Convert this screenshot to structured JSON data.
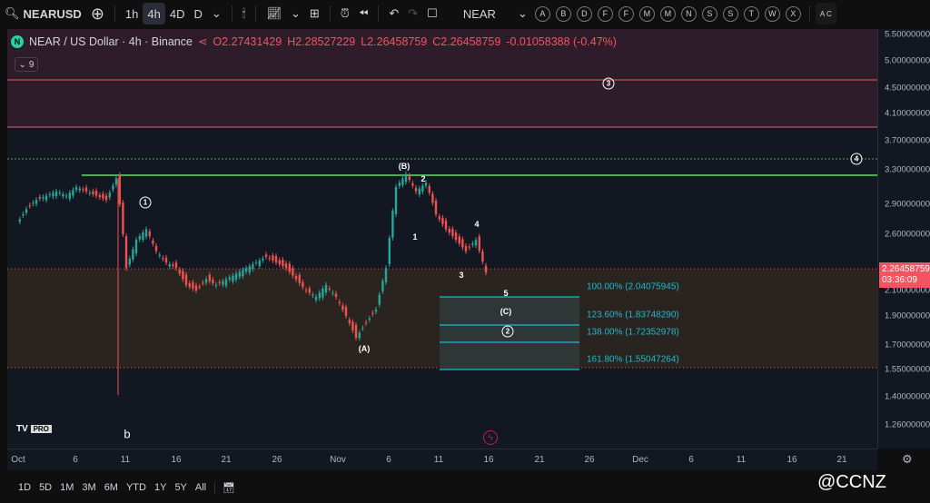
{
  "toolbar": {
    "symbol": "NEARUSD",
    "intervals": [
      "1h",
      "4h",
      "4D",
      "D"
    ],
    "active_interval": "4h",
    "watch_label": "NEAR",
    "letters": [
      "A",
      "B",
      "D",
      "F",
      "F",
      "M",
      "M",
      "N",
      "S",
      "S",
      "T",
      "W",
      "X"
    ],
    "elliott_icon_label": "A C"
  },
  "legend": {
    "title": "NEAR / US Dollar · 4h · Binance",
    "o": "O2.27431429",
    "h": "H2.28527229",
    "l": "L2.26458759",
    "c": "C2.26458759",
    "change": "-0.01058388 (-0.47%)",
    "indicators_count": "9"
  },
  "price_axis": {
    "ticks": [
      "5.50000000",
      "5.00000000",
      "4.50000000",
      "4.10000000",
      "3.70000000",
      "3.30000000",
      "2.90000000",
      "2.60000000",
      "2.10000000",
      "1.90000000",
      "1.70000000",
      "1.55000000",
      "1.40000000",
      "1.26000000"
    ],
    "current_price": "2.26458759",
    "countdown": "03:36:09"
  },
  "time_axis": [
    "Oct",
    "6",
    "11",
    "16",
    "21",
    "26",
    "Nov",
    "6",
    "11",
    "16",
    "21",
    "26",
    "Dec",
    "6",
    "11",
    "16",
    "21"
  ],
  "wave_labels": {
    "w1": "1",
    "wB": "(B)",
    "w2": "2",
    "i": "1",
    "iv": "4",
    "iii": "3",
    "v": "5",
    "wC": "(C)",
    "w2b": "2",
    "wA": "(A)",
    "w3": "3",
    "w4": "4",
    "b": "b"
  },
  "fib_levels": [
    "100.00% (2.04075945)",
    "123.60% (1.83748290)",
    "138.00% (1.72352978)",
    "161.80% (1.55047264)"
  ],
  "ranges": [
    "1D",
    "5D",
    "1M",
    "3M",
    "6M",
    "YTD",
    "1Y",
    "5Y",
    "All"
  ],
  "logo": "TV PRO",
  "watermark": "@CCNZ",
  "colors": {
    "up": "#26a69a",
    "down": "#ef5350",
    "fib": "#22b8cf",
    "price": "#f7525f"
  },
  "prices": [
    2.7,
    2.85,
    2.95,
    3.0,
    3.05,
    3.0,
    3.1,
    3.05,
    3.0,
    2.95,
    3.2,
    2.3,
    2.55,
    2.65,
    2.45,
    2.35,
    2.3,
    2.15,
    2.1,
    2.2,
    2.15,
    2.2,
    2.25,
    2.3,
    2.35,
    2.4,
    2.35,
    2.3,
    2.2,
    2.1,
    2.05,
    2.15,
    2.05,
    1.9,
    1.75,
    1.85,
    1.95,
    2.3,
    3.1,
    3.25,
    3.05,
    3.15,
    2.8,
    2.65,
    2.55,
    2.45,
    2.55,
    2.26
  ]
}
